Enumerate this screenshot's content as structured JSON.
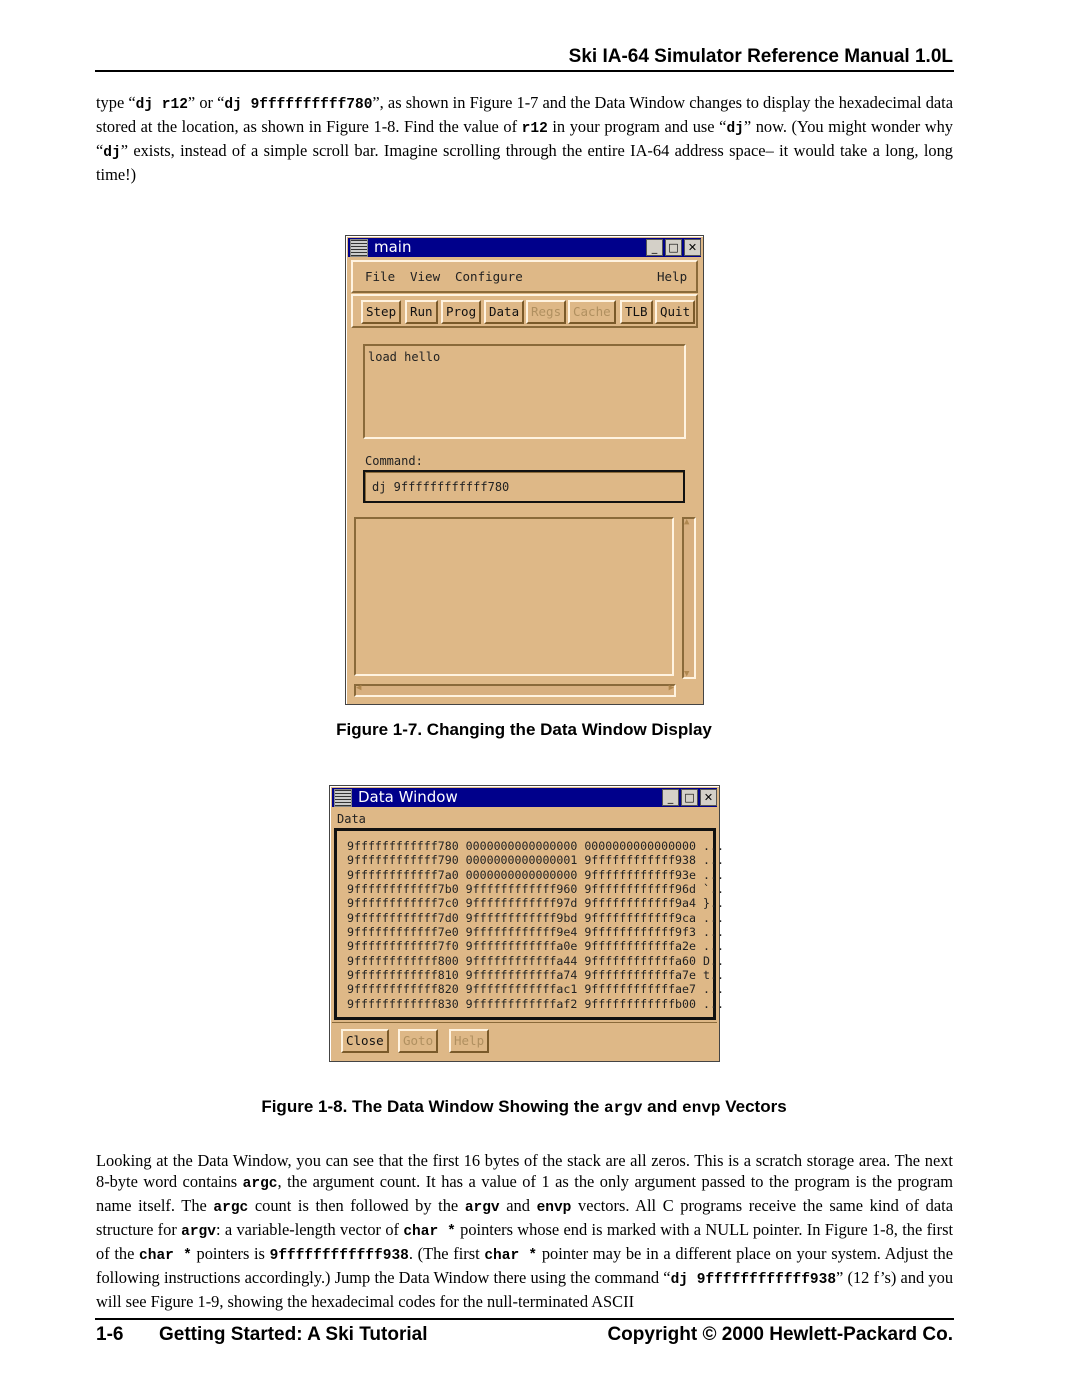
{
  "header": {
    "title": "Ski IA-64 Simulator Reference Manual 1.0L"
  },
  "intro": [
    {
      "t": "type “"
    },
    {
      "t": "dj r12",
      "c": 1
    },
    {
      "t": "” or “"
    },
    {
      "t": "dj 9ffffffffff780",
      "c": 1
    },
    {
      "t": "”, as shown in Figure 1-7 and the Data Window changes to display the hexadecimal data stored at the location, as shown in Figure 1-8. Find the value of "
    },
    {
      "t": "r12",
      "c": 1
    },
    {
      "t": " in your program and use “"
    },
    {
      "t": "dj",
      "c": 1
    },
    {
      "t": "” now. (You might wonder why “"
    },
    {
      "t": "dj",
      "c": 1
    },
    {
      "t": "” exists, instead of a simple scroll bar. Imagine scrolling through the entire IA-64 address space– it would take a long, long time!)"
    }
  ],
  "main_window": {
    "title": "main",
    "menus": [
      "File",
      "View",
      "Configure",
      "Help"
    ],
    "buttons": [
      {
        "label": "Step",
        "enabled": true
      },
      {
        "label": "Run",
        "enabled": true
      },
      {
        "label": "Prog",
        "enabled": true
      },
      {
        "label": "Data",
        "enabled": true
      },
      {
        "label": "Regs",
        "enabled": false
      },
      {
        "label": "Cache",
        "enabled": false
      },
      {
        "label": "TLB",
        "enabled": true
      },
      {
        "label": "Quit",
        "enabled": true
      }
    ],
    "log_text": "load hello",
    "command_label": "Command:",
    "command_value": "dj 9ffffffffffff780"
  },
  "figure1_caption": "Figure 1-7. Changing the Data Window Display",
  "data_window": {
    "title": "Data Window",
    "menu": "Data",
    "rows": [
      [
        "9ffffffffffff780",
        "0000000000000000",
        "0000000000000000",
        "..."
      ],
      [
        "9ffffffffffff790",
        "0000000000000001",
        "9ffffffffffff938",
        "..."
      ],
      [
        "9ffffffffffff7a0",
        "0000000000000000",
        "9ffffffffffff93e",
        "..."
      ],
      [
        "9ffffffffffff7b0",
        "9ffffffffffff960",
        "9ffffffffffff96d",
        "`.."
      ],
      [
        "9ffffffffffff7c0",
        "9ffffffffffff97d",
        "9ffffffffffff9a4",
        "}.."
      ],
      [
        "9ffffffffffff7d0",
        "9ffffffffffff9bd",
        "9ffffffffffff9ca",
        "..."
      ],
      [
        "9ffffffffffff7e0",
        "9ffffffffffff9e4",
        "9ffffffffffff9f3",
        "..."
      ],
      [
        "9ffffffffffff7f0",
        "9ffffffffffffa0e",
        "9ffffffffffffa2e",
        "..."
      ],
      [
        "9ffffffffffff800",
        "9ffffffffffffa44",
        "9ffffffffffffa60",
        "D.."
      ],
      [
        "9ffffffffffff810",
        "9ffffffffffffa74",
        "9ffffffffffffa7e",
        "t.."
      ],
      [
        "9ffffffffffff820",
        "9ffffffffffffac1",
        "9ffffffffffffae7",
        "..."
      ],
      [
        "9ffffffffffff830",
        "9ffffffffffffaf2",
        "9ffffffffffffb00",
        "..."
      ]
    ],
    "buttons": [
      {
        "label": "Close",
        "enabled": true
      },
      {
        "label": "Goto",
        "enabled": false
      },
      {
        "label": "Help",
        "enabled": false
      }
    ]
  },
  "figure2_caption": [
    {
      "t": "Figure 1-8. The Data Window Showing the "
    },
    {
      "t": "argv",
      "c": 1
    },
    {
      "t": " and "
    },
    {
      "t": "envp",
      "c": 1
    },
    {
      "t": " Vectors"
    }
  ],
  "body": [
    {
      "t": "Looking at the Data Window, you can see that the first 16 bytes of the stack are all zeros. This is a scratch storage area. The next 8-byte word contains "
    },
    {
      "t": "argc",
      "c": 1
    },
    {
      "t": ", the argument count. It has a value of 1 as the only argument passed to the program is the program name itself. The "
    },
    {
      "t": "argc",
      "c": 1
    },
    {
      "t": " count is then followed by the "
    },
    {
      "t": "argv",
      "c": 1
    },
    {
      "t": " and "
    },
    {
      "t": "envp",
      "c": 1
    },
    {
      "t": " vectors. All C programs receive the same kind of data structure for "
    },
    {
      "t": "argv",
      "c": 1
    },
    {
      "t": ": a variable-length vector of "
    },
    {
      "t": "char *",
      "c": 1
    },
    {
      "t": " pointers whose end is marked with a NULL pointer. In Figure 1-8, the first of the "
    },
    {
      "t": "char *",
      "c": 1
    },
    {
      "t": " pointers is "
    },
    {
      "t": "9ffffffffffff938",
      "c": 1
    },
    {
      "t": ". (The first "
    },
    {
      "t": "char *",
      "c": 1
    },
    {
      "t": " pointer may be in a different place on your system. Adjust the following instructions accordingly.) Jump the Data Window there using the command “"
    },
    {
      "t": "dj 9ffffffffffff938",
      "c": 1
    },
    {
      "t": "” (12 f’s) and you will see Figure 1-9, showing the hexadecimal codes for the null-terminated ASCII"
    }
  ],
  "footer": {
    "page": "1-6",
    "chapter": "Getting Started: A Ski Tutorial",
    "copyright": "Copyright © 2000 Hewlett-Packard Co."
  },
  "colors": {
    "window_bg": "#deb887",
    "titlebar": "#00008b"
  }
}
